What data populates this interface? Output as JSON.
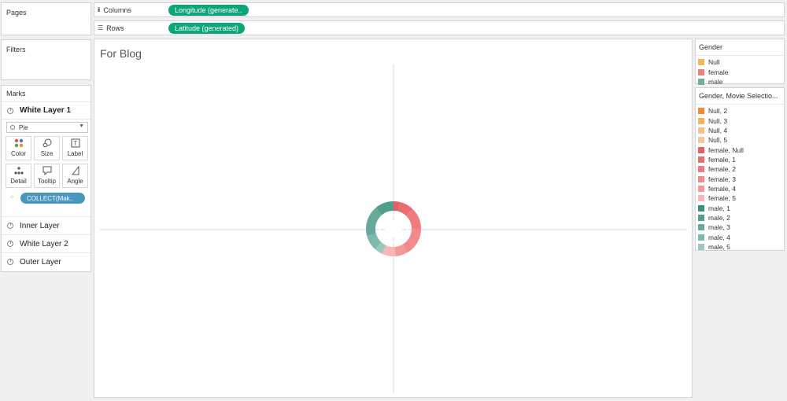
{
  "pages": {
    "title": "Pages"
  },
  "filters": {
    "title": "Filters"
  },
  "marks": {
    "title": "Marks",
    "active_layer": "White Layer 1",
    "mark_type": "Pie",
    "buttons": {
      "color": "Color",
      "size": "Size",
      "label": "Label",
      "detail": "Detail",
      "tooltip": "Tooltip",
      "angle": "Angle"
    },
    "detail_pill": "COLLECT(Mak..",
    "layers": [
      "Inner Layer",
      "White Layer 2",
      "Outer Layer"
    ]
  },
  "shelves": {
    "columns_label": "Columns",
    "columns_pill": "Longitude (generate..",
    "rows_label": "Rows",
    "rows_pill": "Latitude (generated)"
  },
  "viz": {
    "title": "For Blog"
  },
  "legend_gender": {
    "title": "Gender",
    "items": [
      {
        "label": "Null",
        "color": "#f1b85e"
      },
      {
        "label": "female",
        "color": "#f08080"
      },
      {
        "label": "male",
        "color": "#7ba99d"
      }
    ]
  },
  "legend_movie": {
    "title": "Gender, Movie Selectio...",
    "items": [
      {
        "label": "Null, 2",
        "color": "#f28b32"
      },
      {
        "label": "Null, 3",
        "color": "#f3b25d"
      },
      {
        "label": "Null, 4",
        "color": "#f6c386"
      },
      {
        "label": "Null, 5",
        "color": "#f8c79a"
      },
      {
        "label": "female, Null",
        "color": "#e35e65"
      },
      {
        "label": "female, 1",
        "color": "#eb6b6f"
      },
      {
        "label": "female, 2",
        "color": "#ee7b7d"
      },
      {
        "label": "female, 3",
        "color": "#f2898a"
      },
      {
        "label": "female, 4",
        "color": "#f59a9a"
      },
      {
        "label": "female, 5",
        "color": "#f8b7b6"
      },
      {
        "label": "male, 1",
        "color": "#3f8f80"
      },
      {
        "label": "male, 2",
        "color": "#539c8e"
      },
      {
        "label": "male, 3",
        "color": "#67a99c"
      },
      {
        "label": "male, 4",
        "color": "#7fb8ad"
      },
      {
        "label": "male, 5",
        "color": "#9ac7be"
      }
    ]
  }
}
